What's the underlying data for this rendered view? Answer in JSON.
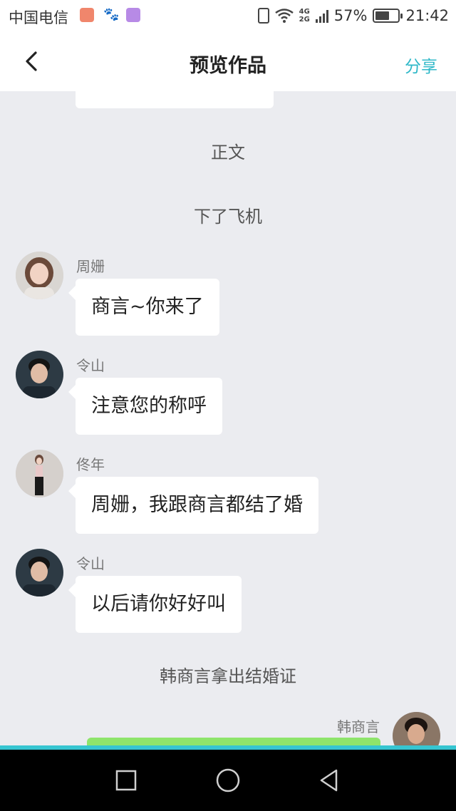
{
  "status_bar": {
    "carrier": "中国电信",
    "network_top": "4G",
    "network_bottom": "2G",
    "battery": "57%",
    "time": "21:42",
    "icons": [
      "mail-icon",
      "baidu-paw-icon",
      "gallery-icon",
      "vibrate-icon",
      "wifi-icon",
      "signal-icon",
      "battery-icon"
    ]
  },
  "header": {
    "title": "预览作品",
    "share_label": "分享",
    "accent_color": "#2fb8c8"
  },
  "narrations": {
    "section": "正文",
    "line1": "下了飞机",
    "line2": "韩商言拿出结婚证"
  },
  "messages": [
    {
      "speaker": "周姗",
      "text": "商言~你来了",
      "avatar": "female-avatar"
    },
    {
      "speaker": "令山",
      "text": "注意您的称呼",
      "avatar": "male-avatar"
    },
    {
      "speaker": "佟年",
      "text": "周姗，我跟商言都结了婚",
      "avatar": "female-avatar"
    },
    {
      "speaker": "令山",
      "text": "以后请你好好叫",
      "avatar": "male-avatar"
    }
  ],
  "right_message": {
    "speaker": "韩商言",
    "avatar": "male-avatar",
    "bubble_color": "#8ee46b"
  },
  "colors": {
    "background": "#ebecf0",
    "bubble": "#ffffff",
    "bottom_accent": "#36c5d1"
  }
}
